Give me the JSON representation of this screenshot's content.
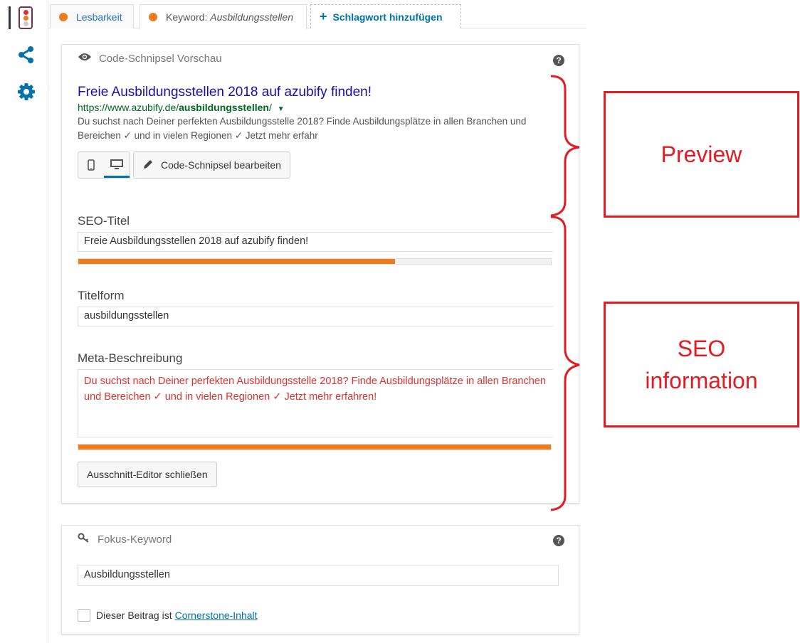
{
  "sidebar": {
    "items": [
      {
        "icon": "traffic-light-icon"
      },
      {
        "icon": "share-icon"
      },
      {
        "icon": "gear-icon"
      }
    ],
    "colors": {
      "icon": "#0073aa",
      "traffic_frame": "#7a3145",
      "red": "#dc3232",
      "orange": "#ee7c1b",
      "grey": "#cccccc"
    }
  },
  "tabs": [
    {
      "label": "Lesbarkeit",
      "status": "orange"
    },
    {
      "label_prefix": "Keyword: ",
      "label_keyword": "Ausbildungsstellen",
      "status": "orange"
    },
    {
      "label": "Schlagwort hinzufügen",
      "icon": "plus-icon"
    }
  ],
  "snippet_preview": {
    "heading": "Code-Schnipsel Vorschau",
    "help": "?",
    "title": "Freie Ausbildungsstellen 2018 auf azubify finden!",
    "url_base": "https://www.azubify.de/",
    "url_slug": "ausbildungsstellen",
    "url_suffix": "/",
    "description": "Du suchst nach Deiner perfekten Ausbildungsstelle 2018? Finde Ausbildungsplätze in allen Branchen und Bereichen ✓ und in vielen Regionen ✓ Jetzt mehr erfahr",
    "edit_button": "Code-Schnipsel bearbeiten",
    "active_device": "desktop"
  },
  "editor": {
    "seo_title_label": "SEO-Titel",
    "seo_title_value": "Freie Ausbildungsstellen 2018 auf azubify finden!",
    "seo_title_progress": 0.67,
    "slug_label": "Titelform",
    "slug_value": "ausbildungsstellen",
    "meta_label": "Meta-Beschreibung",
    "meta_value": "Du suchst nach Deiner perfekten Ausbildungsstelle 2018? Finde Ausbildungsplätze in allen Branchen und Bereichen ✓ und in vielen Regionen ✓ Jetzt mehr erfahren!",
    "meta_progress": 1.0,
    "close_button": "Ausschnitt-Editor schließen"
  },
  "focus_keyword": {
    "heading": "Fokus-Keyword",
    "help": "?",
    "value": "Ausbildungsstellen",
    "cornerstone_text": "Dieser Beitrag ist",
    "cornerstone_link": "Cornerstone-Inhalt",
    "cornerstone_checked": false
  },
  "annotations": {
    "preview": "Preview",
    "seo_line1": "SEO",
    "seo_line2": "information",
    "color": "#e31b23"
  }
}
